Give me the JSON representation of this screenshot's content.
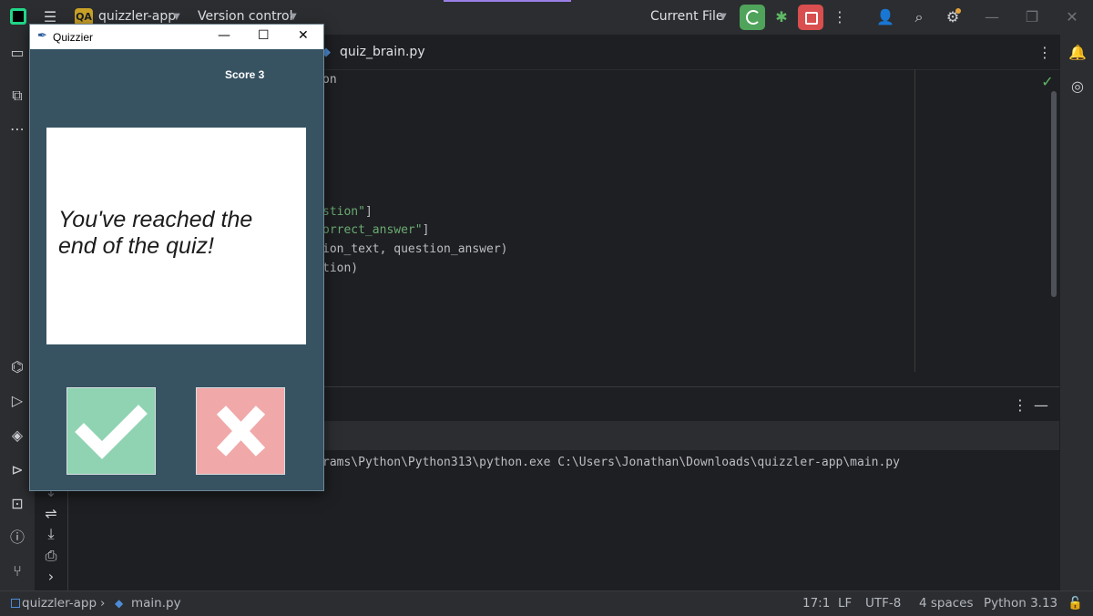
{
  "titlebar": {
    "project_badge": "QA",
    "project": "quizzler-app",
    "vcs": "Version control",
    "run_config": "Current File"
  },
  "editor": {
    "tab": "quiz_brain.py",
    "lines": [
      {
        "parts": [
          [
            "on",
            ""
          ]
        ]
      },
      {
        "parts": [
          [
            "stion\"",
            "str"
          ],
          [
            "]",
            ""
          ]
        ]
      },
      {
        "parts": [
          [
            "orrect_answer\"",
            "str"
          ],
          [
            "]",
            ""
          ]
        ]
      },
      {
        "parts": [
          [
            "ion_text, question_answer)",
            ""
          ]
        ]
      },
      {
        "parts": [
          [
            "tion)",
            ""
          ]
        ]
      }
    ]
  },
  "console": {
    "command": "rams\\Python\\Python313\\python.exe C:\\Users\\Jonathan\\Downloads\\quizzler-app\\main.py"
  },
  "status": {
    "breadcrumb_project": "quizzler-app",
    "breadcrumb_file": "main.py",
    "position": "17:1",
    "line_sep": "LF",
    "encoding": "UTF-8",
    "indent": "4 spaces",
    "interpreter": "Python 3.13"
  },
  "quiz_window": {
    "title": "Quizzier",
    "score": "Score 3",
    "question": "You've reached the end of the quiz!",
    "true_icon": "check-mark-icon",
    "false_icon": "x-mark-icon",
    "colors": {
      "background": "#375362",
      "true": "#8fd3b2",
      "false": "#f0a8a8"
    }
  }
}
